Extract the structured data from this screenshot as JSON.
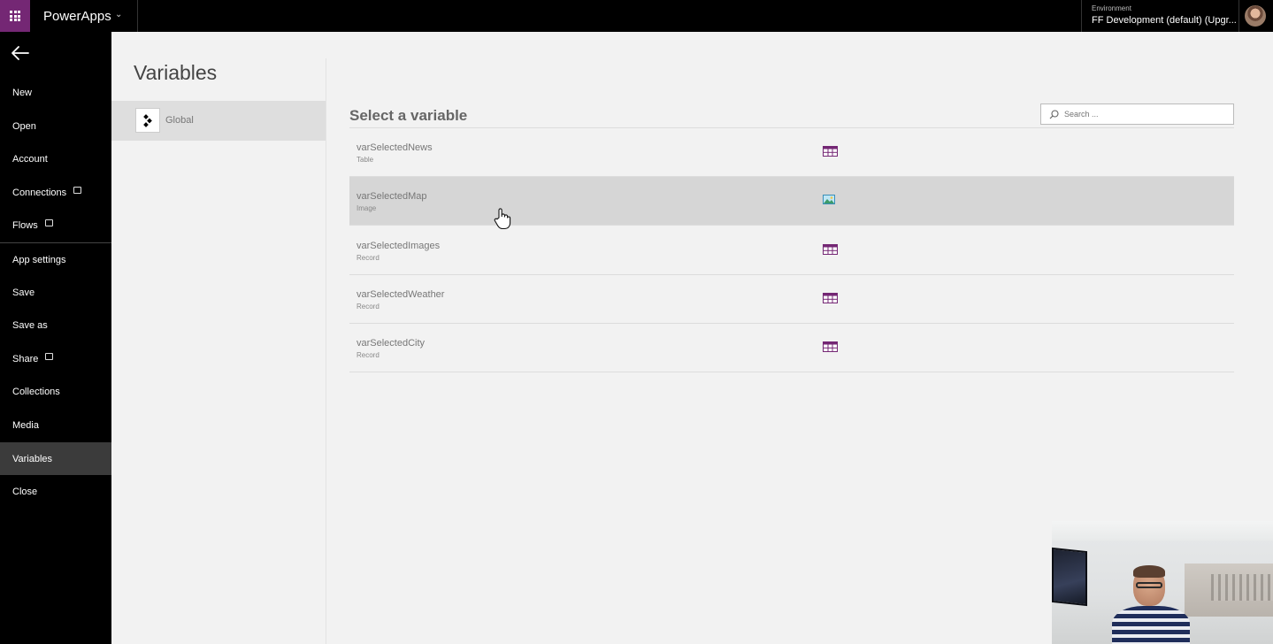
{
  "topbar": {
    "app_name": "PowerApps",
    "environment_label": "Environment",
    "environment_value": "FF Development (default) (Upgr..."
  },
  "sidebar": {
    "items": [
      {
        "label": "New",
        "external": false
      },
      {
        "label": "Open",
        "external": false
      },
      {
        "label": "Account",
        "external": false
      },
      {
        "label": "Connections",
        "external": true
      },
      {
        "label": "Flows",
        "external": true
      },
      {
        "label": "App settings",
        "external": false
      },
      {
        "label": "Save",
        "external": false
      },
      {
        "label": "Save as",
        "external": false
      },
      {
        "label": "Share",
        "external": true
      },
      {
        "label": "Collections",
        "external": false
      },
      {
        "label": "Media",
        "external": false
      },
      {
        "label": "Variables",
        "external": false,
        "active": true
      },
      {
        "label": "Close",
        "external": false
      }
    ]
  },
  "variables_panel": {
    "title": "Variables",
    "scopes": [
      {
        "label": "Global",
        "icon": "global-scope-icon"
      }
    ]
  },
  "main": {
    "title": "Select a variable",
    "search_placeholder": "Search ...",
    "variables": [
      {
        "name": "varSelectedNews",
        "type": "Table",
        "icon": "table-icon",
        "selected": false
      },
      {
        "name": "varSelectedMap",
        "type": "Image",
        "icon": "image-icon",
        "selected": true
      },
      {
        "name": "varSelectedImages",
        "type": "Record",
        "icon": "table-icon",
        "selected": false
      },
      {
        "name": "varSelectedWeather",
        "type": "Record",
        "icon": "table-icon",
        "selected": false
      },
      {
        "name": "varSelectedCity",
        "type": "Record",
        "icon": "table-icon",
        "selected": false
      }
    ]
  },
  "colors": {
    "brand": "#742774",
    "sidebar_bg": "#000000",
    "sidebar_active": "#3b3b3b",
    "row_selected": "#d6d6d6",
    "type_icon": "#742774"
  }
}
